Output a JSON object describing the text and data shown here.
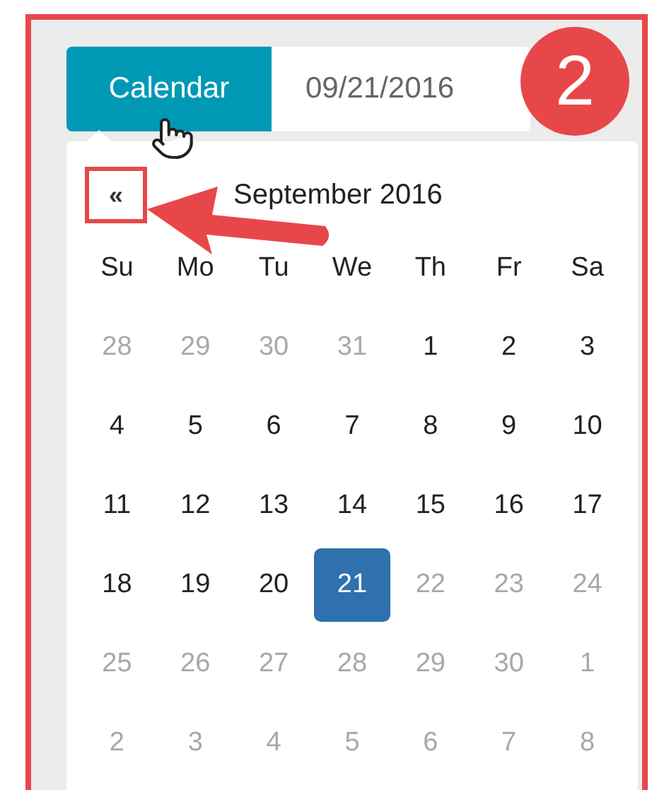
{
  "annotation": {
    "step": "2"
  },
  "picker": {
    "button": "Calendar",
    "value": "09/21/2016"
  },
  "calendar": {
    "prev": "«",
    "title": "September 2016",
    "weekdays": [
      "Su",
      "Mo",
      "Tu",
      "We",
      "Th",
      "Fr",
      "Sa"
    ],
    "days": [
      {
        "label": "28",
        "disabled": true,
        "selected": false
      },
      {
        "label": "29",
        "disabled": true,
        "selected": false
      },
      {
        "label": "30",
        "disabled": true,
        "selected": false
      },
      {
        "label": "31",
        "disabled": true,
        "selected": false
      },
      {
        "label": "1",
        "disabled": false,
        "selected": false
      },
      {
        "label": "2",
        "disabled": false,
        "selected": false
      },
      {
        "label": "3",
        "disabled": false,
        "selected": false
      },
      {
        "label": "4",
        "disabled": false,
        "selected": false
      },
      {
        "label": "5",
        "disabled": false,
        "selected": false
      },
      {
        "label": "6",
        "disabled": false,
        "selected": false
      },
      {
        "label": "7",
        "disabled": false,
        "selected": false
      },
      {
        "label": "8",
        "disabled": false,
        "selected": false
      },
      {
        "label": "9",
        "disabled": false,
        "selected": false
      },
      {
        "label": "10",
        "disabled": false,
        "selected": false
      },
      {
        "label": "11",
        "disabled": false,
        "selected": false
      },
      {
        "label": "12",
        "disabled": false,
        "selected": false
      },
      {
        "label": "13",
        "disabled": false,
        "selected": false
      },
      {
        "label": "14",
        "disabled": false,
        "selected": false
      },
      {
        "label": "15",
        "disabled": false,
        "selected": false
      },
      {
        "label": "16",
        "disabled": false,
        "selected": false
      },
      {
        "label": "17",
        "disabled": false,
        "selected": false
      },
      {
        "label": "18",
        "disabled": false,
        "selected": false
      },
      {
        "label": "19",
        "disabled": false,
        "selected": false
      },
      {
        "label": "20",
        "disabled": false,
        "selected": false
      },
      {
        "label": "21",
        "disabled": false,
        "selected": true
      },
      {
        "label": "22",
        "disabled": true,
        "selected": false
      },
      {
        "label": "23",
        "disabled": true,
        "selected": false
      },
      {
        "label": "24",
        "disabled": true,
        "selected": false
      },
      {
        "label": "25",
        "disabled": true,
        "selected": false
      },
      {
        "label": "26",
        "disabled": true,
        "selected": false
      },
      {
        "label": "27",
        "disabled": true,
        "selected": false
      },
      {
        "label": "28",
        "disabled": true,
        "selected": false
      },
      {
        "label": "29",
        "disabled": true,
        "selected": false
      },
      {
        "label": "30",
        "disabled": true,
        "selected": false
      },
      {
        "label": "1",
        "disabled": true,
        "selected": false
      },
      {
        "label": "2",
        "disabled": true,
        "selected": false
      },
      {
        "label": "3",
        "disabled": true,
        "selected": false
      },
      {
        "label": "4",
        "disabled": true,
        "selected": false
      },
      {
        "label": "5",
        "disabled": true,
        "selected": false
      },
      {
        "label": "6",
        "disabled": true,
        "selected": false
      },
      {
        "label": "7",
        "disabled": true,
        "selected": false
      },
      {
        "label": "8",
        "disabled": true,
        "selected": false
      }
    ]
  }
}
